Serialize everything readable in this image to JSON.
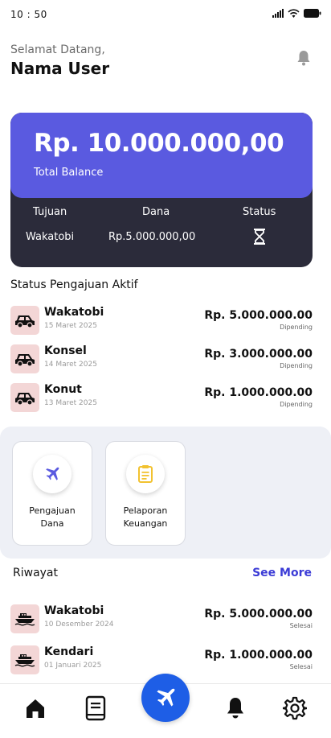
{
  "status_bar": {
    "time": "10 : 50"
  },
  "header": {
    "greeting": "Selamat Datang,",
    "username": "Nama User"
  },
  "balance": {
    "amount": "Rp. 10.000.000,00",
    "label": "Total Balance",
    "table": {
      "headers": [
        "Tujuan",
        "Dana",
        "Status"
      ],
      "row": {
        "tujuan": "Wakatobi",
        "dana": "Rp.5.000.000,00",
        "status_icon": "hourglass-icon"
      }
    }
  },
  "active": {
    "title": "Status Pengajuan Aktif",
    "items": [
      {
        "name": "Wakatobi",
        "date": "15 Maret 2025",
        "amount": "Rp. 5.000.000.00",
        "status": "Dipending",
        "icon": "car-icon"
      },
      {
        "name": "Konsel",
        "date": "14 Maret 2025",
        "amount": "Rp. 3.000.000.00",
        "status": "Dipending",
        "icon": "car-icon"
      },
      {
        "name": "Konut",
        "date": "13 Maret 2025",
        "amount": "Rp. 1.000.000.00",
        "status": "Dipending",
        "icon": "car-icon"
      }
    ]
  },
  "menu": {
    "items": [
      {
        "label_line1": "Pengajuan",
        "label_line2": "Dana",
        "icon": "airplane-icon",
        "icon_color": "#5a5ae0"
      },
      {
        "label_line1": "Pelaporan",
        "label_line2": "Keuangan",
        "icon": "clipboard-icon",
        "icon_color": "#f2c230"
      }
    ]
  },
  "history": {
    "title": "Riwayat",
    "see_more": "See More",
    "items": [
      {
        "name": "Wakatobi",
        "date": "10 Desember 2024",
        "amount": "Rp. 5.000.000.00",
        "status": "Selesai",
        "icon": "ship-icon"
      },
      {
        "name": "Kendari",
        "date": "01 Januari 2025",
        "amount": "Rp. 1.000.000.00",
        "status": "Selesai",
        "icon": "ship-icon"
      }
    ]
  },
  "nav": {
    "items": [
      "home-icon",
      "book-icon",
      "airplane-icon",
      "bell-icon",
      "gear-icon"
    ],
    "accent": "#1e5ee6"
  },
  "colors": {
    "primary": "#5a5ae0",
    "card_dark": "#2b2b3a",
    "thumb_bg": "#f3d6d6",
    "link": "#3b3bd6"
  }
}
